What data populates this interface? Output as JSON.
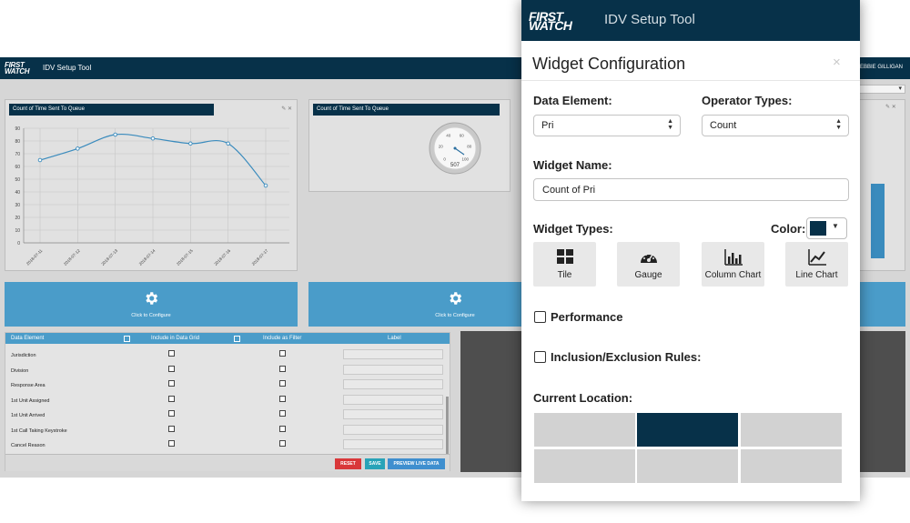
{
  "background_app": {
    "logo_line1": "FIRST",
    "logo_line2": "WATCH",
    "title": "IDV Setup Tool",
    "user": "DEBBIE GILLIGAN"
  },
  "line_panel": {
    "title": "Count of Time Sent To Queue",
    "tools": "✎ ✕"
  },
  "gauge_panel": {
    "title": "Count of Time Sent To Queue",
    "gauge_value": "507"
  },
  "chart_data": [
    {
      "type": "line",
      "title": "Count of Time Sent To Queue",
      "categories": [
        "2018-07-11",
        "2018-07-12",
        "2018-07-13",
        "2018-07-14",
        "2018-07-15",
        "2018-07-16",
        "2018-07-17"
      ],
      "series": [
        {
          "values": [
            65,
            74,
            85,
            82,
            78,
            78,
            45
          ]
        }
      ],
      "ylim": [
        0,
        90
      ],
      "yticks": [
        0,
        10,
        20,
        30,
        40,
        50,
        60,
        70,
        80,
        90
      ],
      "grid": true,
      "color": "#3a8bbd"
    },
    {
      "type": "gauge",
      "value": 507,
      "tick_labels": [
        "0",
        "20",
        "40",
        "60",
        "80",
        "100"
      ]
    }
  ],
  "config_buttons": {
    "label": "Click to Configure"
  },
  "data_grid": {
    "headers": {
      "data_element": "Data Element",
      "include_grid": "Include in Data Grid",
      "include_filter": "Include as Filter",
      "label": "Label"
    },
    "rows": [
      "Jurisdiction",
      "Division",
      "Response Area",
      "1st Unit Assigned",
      "1st Unit Arrived",
      "1st Call Taking Keystroke",
      "Cancel Reason"
    ],
    "buttons": {
      "reset": "RESET",
      "save": "SAVE",
      "preview": "PREVIEW LIVE DATA"
    },
    "button_colors": {
      "reset": "#d9383a",
      "save": "#29a3b8",
      "preview": "#3f8fcf"
    }
  },
  "modal": {
    "logo_line1": "FIRST",
    "logo_line2": "WATCH",
    "app_title": "IDV Setup Tool",
    "title": "Widget Configuration",
    "close": "×",
    "data_element_label": "Data Element:",
    "data_element_value": "Pri",
    "operator_label": "Operator Types:",
    "operator_value": "Count",
    "widget_name_label": "Widget Name:",
    "widget_name_value": "Count of Pri",
    "widget_types_label": "Widget Types:",
    "color_label": "Color:",
    "color_value": "#073149",
    "widget_types": [
      {
        "label": "Tile",
        "icon": "tile-icon"
      },
      {
        "label": "Gauge",
        "icon": "gauge-icon"
      },
      {
        "label": "Column Chart",
        "icon": "column-chart-icon"
      },
      {
        "label": "Line Chart",
        "icon": "line-chart-icon"
      }
    ],
    "performance_label": "Performance",
    "inclusion_label": "Inclusion/Exclusion Rules:",
    "current_location_label": "Current Location:",
    "location_grid": {
      "rows": 2,
      "cols": 3,
      "selected_row": 1,
      "selected_col": 2
    }
  }
}
